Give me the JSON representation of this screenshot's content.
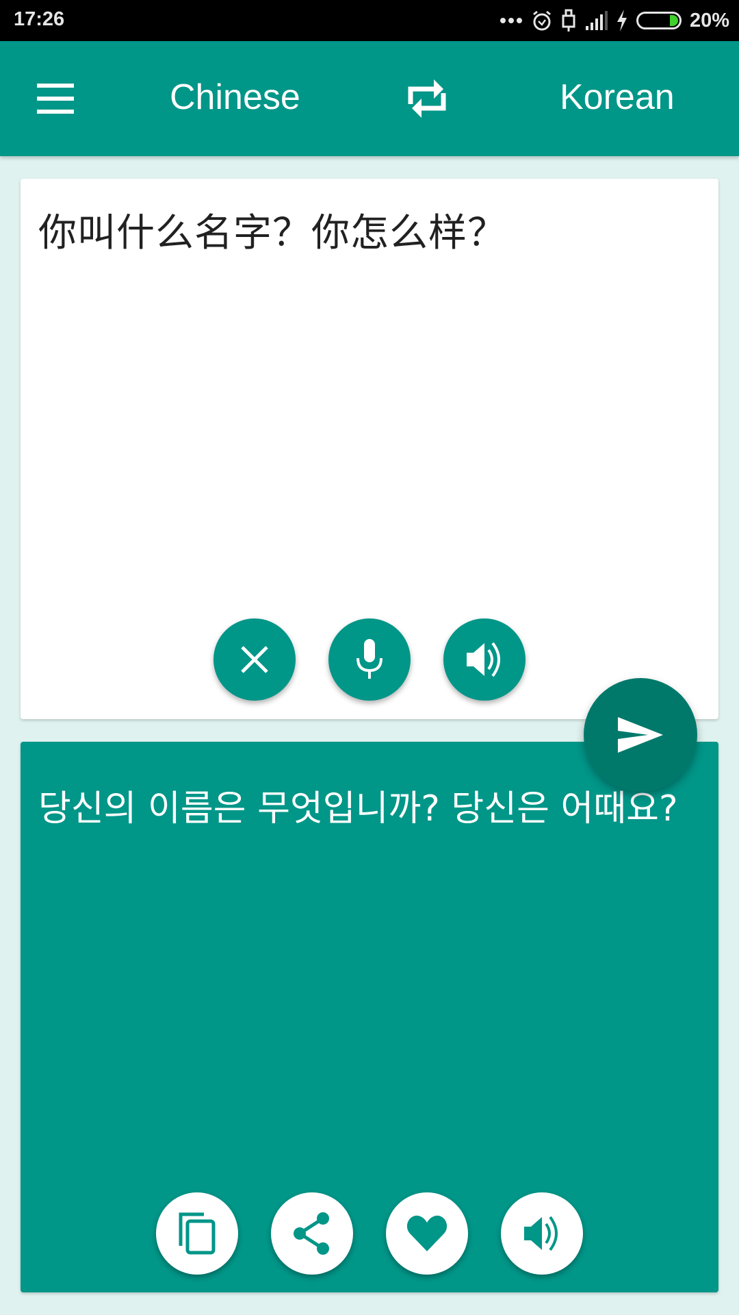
{
  "status_bar": {
    "time": "17:26",
    "battery_percent": "20%",
    "battery_level": 0.2,
    "icons": [
      "more-dots-icon",
      "alarm-icon",
      "usb-icon",
      "signal-icon",
      "charging-bolt-icon",
      "battery-icon"
    ]
  },
  "toolbar": {
    "menu_icon": "hamburger-menu-icon",
    "source_language": "Chinese",
    "swap_icon": "swap-languages-icon",
    "target_language": "Korean"
  },
  "input_card": {
    "text": "你叫什么名字？你怎么样？",
    "buttons": [
      {
        "name": "clear-button",
        "icon": "close-icon"
      },
      {
        "name": "microphone-button",
        "icon": "microphone-icon"
      },
      {
        "name": "speak-source-button",
        "icon": "speaker-icon"
      }
    ]
  },
  "translate_button": {
    "icon": "send-icon"
  },
  "output_card": {
    "text": "당신의 이름은 무엇입니까? 당신은 어때요?",
    "buttons": [
      {
        "name": "copy-button",
        "icon": "copy-icon"
      },
      {
        "name": "share-button",
        "icon": "share-icon"
      },
      {
        "name": "favorite-button",
        "icon": "heart-icon"
      },
      {
        "name": "speak-translation-button",
        "icon": "speaker-icon"
      }
    ]
  },
  "colors": {
    "primary": "#009688",
    "primary_dark": "#00796b",
    "background": "#dff2ef",
    "battery_green": "#3fd12b"
  }
}
